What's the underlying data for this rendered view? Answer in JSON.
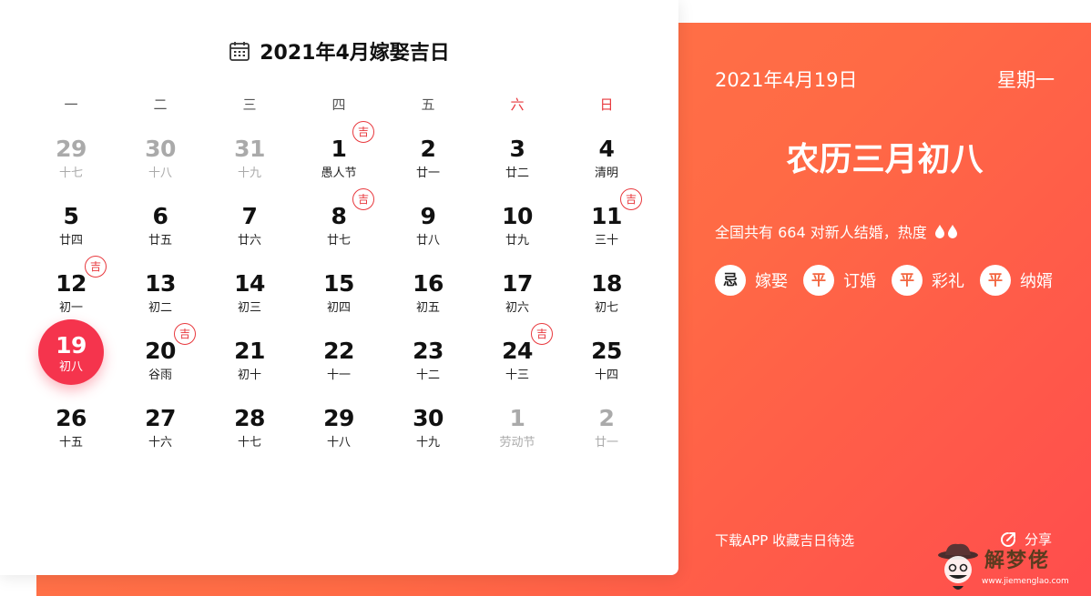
{
  "calendar": {
    "title": "2021年4月嫁娶吉日",
    "weekdays": [
      "一",
      "二",
      "三",
      "四",
      "五",
      "六",
      "日"
    ],
    "weekday_colors": {
      "weekend": "#e8383d",
      "normal": "#555555"
    },
    "badge_label": "吉",
    "selected_day": "19",
    "weeks": [
      [
        {
          "day": "29",
          "sub": "十七",
          "dim": true
        },
        {
          "day": "30",
          "sub": "十八",
          "dim": true
        },
        {
          "day": "31",
          "sub": "十九",
          "dim": true
        },
        {
          "day": "1",
          "sub": "愚人节",
          "ji": true
        },
        {
          "day": "2",
          "sub": "廿一"
        },
        {
          "day": "3",
          "sub": "廿二"
        },
        {
          "day": "4",
          "sub": "清明"
        }
      ],
      [
        {
          "day": "5",
          "sub": "廿四"
        },
        {
          "day": "6",
          "sub": "廿五"
        },
        {
          "day": "7",
          "sub": "廿六"
        },
        {
          "day": "8",
          "sub": "廿七",
          "ji": true
        },
        {
          "day": "9",
          "sub": "廿八"
        },
        {
          "day": "10",
          "sub": "廿九"
        },
        {
          "day": "11",
          "sub": "三十",
          "ji": true
        }
      ],
      [
        {
          "day": "12",
          "sub": "初一",
          "ji": true
        },
        {
          "day": "13",
          "sub": "初二"
        },
        {
          "day": "14",
          "sub": "初三"
        },
        {
          "day": "15",
          "sub": "初四"
        },
        {
          "day": "16",
          "sub": "初五"
        },
        {
          "day": "17",
          "sub": "初六"
        },
        {
          "day": "18",
          "sub": "初七"
        }
      ],
      [
        {
          "day": "19",
          "sub": "初八",
          "selected": true
        },
        {
          "day": "20",
          "sub": "谷雨",
          "ji": true
        },
        {
          "day": "21",
          "sub": "初十"
        },
        {
          "day": "22",
          "sub": "十一"
        },
        {
          "day": "23",
          "sub": "十二"
        },
        {
          "day": "24",
          "sub": "十三",
          "ji": true
        },
        {
          "day": "25",
          "sub": "十四"
        }
      ],
      [
        {
          "day": "26",
          "sub": "十五"
        },
        {
          "day": "27",
          "sub": "十六"
        },
        {
          "day": "28",
          "sub": "十七"
        },
        {
          "day": "29",
          "sub": "十八"
        },
        {
          "day": "30",
          "sub": "十九"
        },
        {
          "day": "1",
          "sub": "劳动节",
          "dim": true
        },
        {
          "day": "2",
          "sub": "廿一",
          "dim": true
        }
      ]
    ]
  },
  "detail": {
    "date": "2021年4月19日",
    "weekday": "星期一",
    "lunar": "农历三月初八",
    "stat": "全国共有 664 对新人结婚，热度",
    "heat_level": 2,
    "tags": [
      {
        "mark": "忌",
        "label": "嫁娶"
      },
      {
        "mark": "平",
        "label": "订婚"
      },
      {
        "mark": "平",
        "label": "彩礼"
      },
      {
        "mark": "平",
        "label": "纳婿"
      }
    ],
    "download": "下载APP 收藏吉日待选",
    "share": "分享"
  },
  "watermark": {
    "brand": "解梦佬",
    "url": "www.jiemenglao.com"
  },
  "colors": {
    "accent_red": "#f5344d",
    "orange": "#ff6a45",
    "dim_text": "#aaaaaa"
  }
}
